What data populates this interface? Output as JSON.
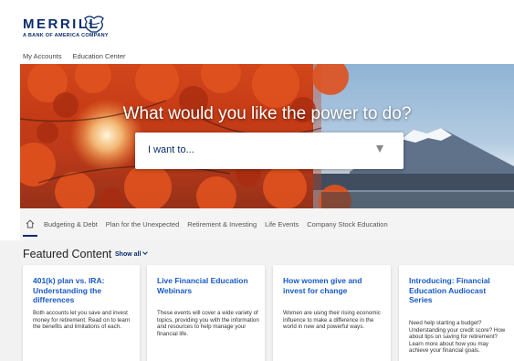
{
  "brand": {
    "name": "MERRILL",
    "tagline": "A BANK OF AMERICA COMPANY",
    "color": "#0a2d6e"
  },
  "topnav": {
    "items": [
      "My Accounts",
      "Education Center"
    ]
  },
  "hero": {
    "title": "What would you like the power to do?",
    "select_value": "I want to..."
  },
  "tabs": {
    "home_icon": "home-icon",
    "items": [
      "Budgeting & Debt",
      "Plan for the Unexpected",
      "Retirement & Investing",
      "Life Events",
      "Company Stock Education"
    ]
  },
  "featured": {
    "title": "Featured Content",
    "show_all": "Show all",
    "cards": [
      {
        "title": "401(k) plan vs. IRA: Understanding the differences",
        "body": "Both accounts let you save and invest money for retirement. Read on to learn the benefits and limitations of each."
      },
      {
        "title": "Live Financial Education Webinars",
        "body": "These events will cover a wide variety of topics, providing you with the information and resources to help manage your financial life."
      },
      {
        "title": "How women give and invest for change",
        "body": "Women are using their rising economic influence to make a difference in the world in new and powerful ways."
      },
      {
        "title": "Introducing: Financial Education Audiocast Series",
        "body": "Need help starting a budget? Understanding your credit score? How about tips on saving for retirement? Learn more about how you may achieve your financial goals."
      }
    ]
  },
  "colors": {
    "link_blue": "#1859c4",
    "hero_red": "#c43a14"
  }
}
